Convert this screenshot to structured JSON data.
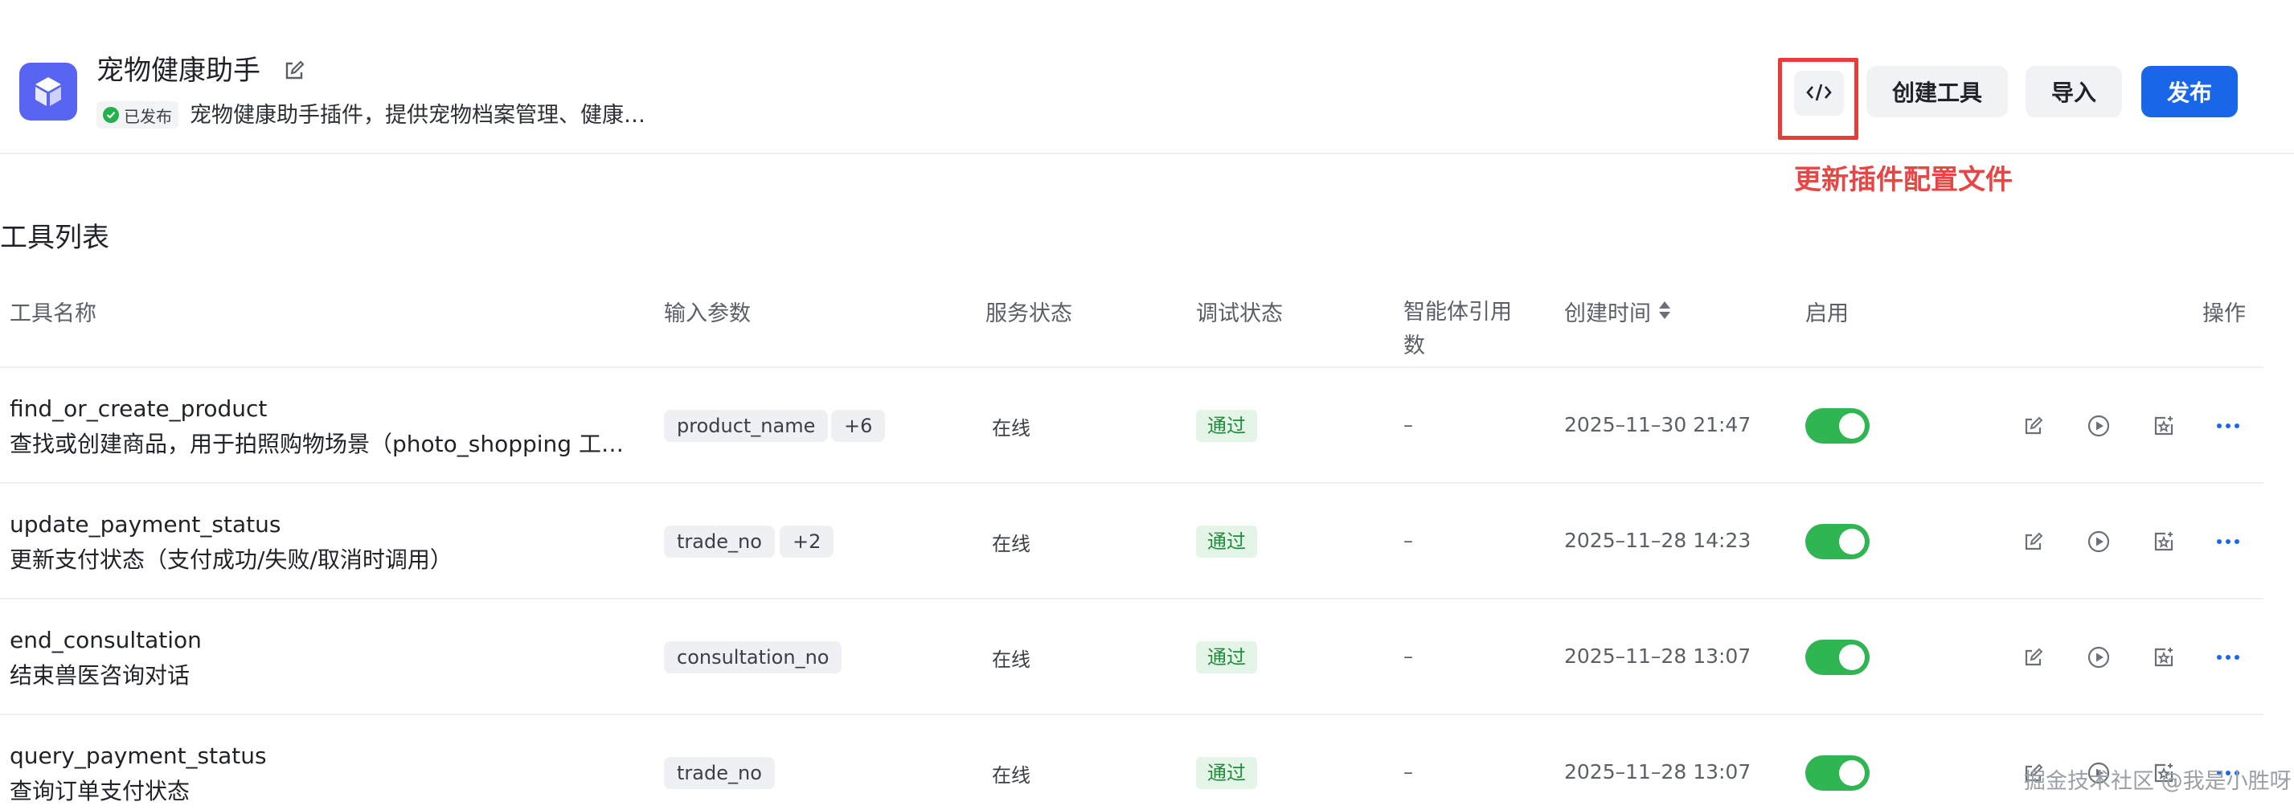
{
  "header": {
    "plugin_name": "宠物健康助手",
    "status_label": "已发布",
    "description": "宠物健康助手插件，提供宠物档案管理、健康…",
    "create_tool_label": "创建工具",
    "import_label": "导入",
    "publish_label": "发布",
    "annotation": "更新插件配置文件",
    "accent_color": "#1966e8",
    "logo_color": "#5865f2"
  },
  "section_title": "工具列表",
  "table": {
    "columns": {
      "name": "工具名称",
      "params": "输入参数",
      "service_status": "服务状态",
      "debug_status": "调试状态",
      "references_line1": "智能体引用",
      "references_line2": "数",
      "created": "创建时间",
      "enabled": "启用",
      "actions": "操作"
    },
    "rows": [
      {
        "name": "find_or_create_product",
        "desc": "查找或创建商品，用于拍照购物场景（photo_shopping 工…",
        "param": "product_name",
        "param_more": "+6",
        "service_status": "在线",
        "debug_status": "通过",
        "references": "–",
        "created": "2025–11–30 21:47",
        "enabled": true
      },
      {
        "name": "update_payment_status",
        "desc": "更新支付状态（支付成功/失败/取消时调用）",
        "param": "trade_no",
        "param_more": "+2",
        "service_status": "在线",
        "debug_status": "通过",
        "references": "–",
        "created": "2025–11–28 14:23",
        "enabled": true
      },
      {
        "name": "end_consultation",
        "desc": "结束兽医咨询对话",
        "param": "consultation_no",
        "param_more": "",
        "service_status": "在线",
        "debug_status": "通过",
        "references": "–",
        "created": "2025–11–28 13:07",
        "enabled": true
      },
      {
        "name": "query_payment_status",
        "desc": "查询订单支付状态",
        "param": "trade_no",
        "param_more": "",
        "service_status": "在线",
        "debug_status": "通过",
        "references": "–",
        "created": "2025–11–28 13:07",
        "enabled": true
      }
    ]
  },
  "icons": [
    "cube-logo-icon",
    "edit-icon",
    "check-icon",
    "code-icon",
    "sort-icon",
    "play-icon",
    "star-box-icon",
    "more-icon"
  ],
  "watermark": "掘金技术社区 @我是小胜呀"
}
